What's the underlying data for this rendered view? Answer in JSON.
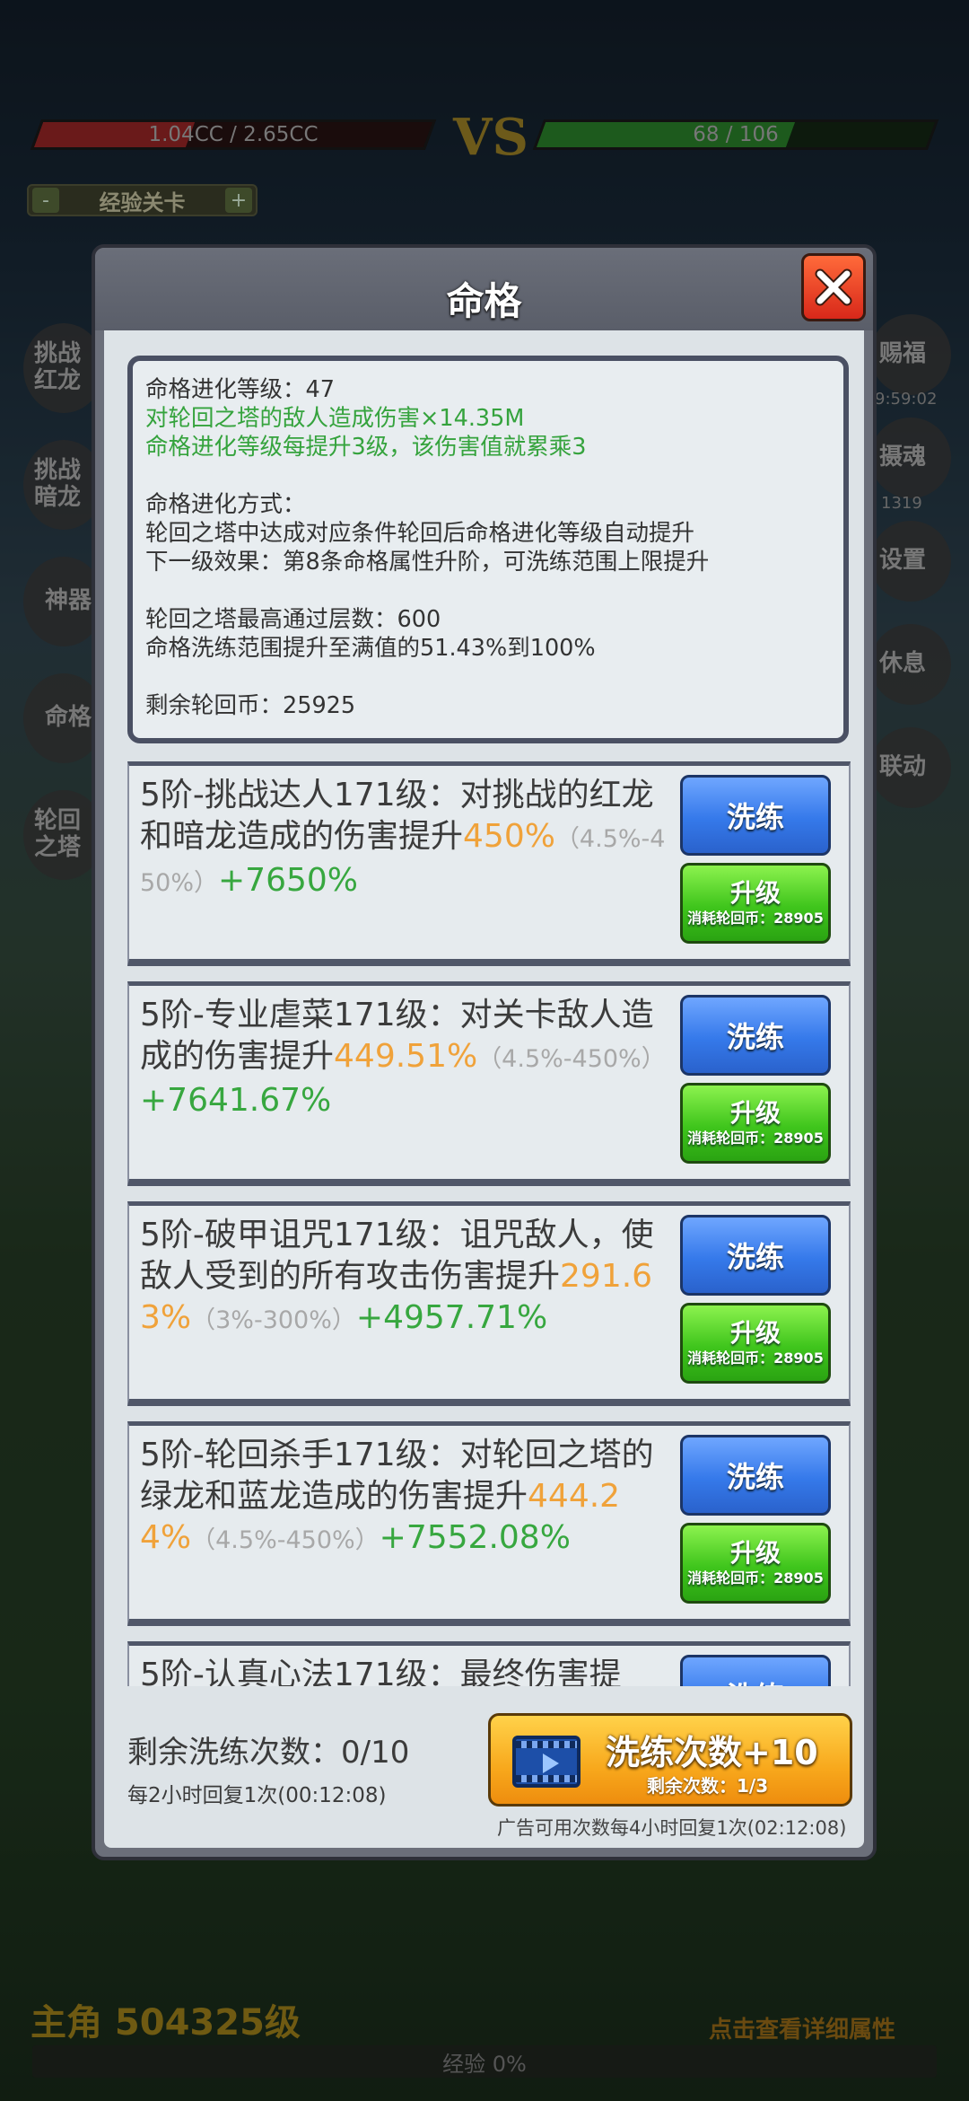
{
  "battle": {
    "player_hp": "1.04CC / 2.65CC",
    "enemy_hp": "68 / 106",
    "vs": "VS",
    "stage_label": "经验关卡",
    "minus": "-",
    "plus": "+"
  },
  "side_left": [
    "挑战红龙",
    "挑战暗龙",
    "神器",
    "命格",
    "轮回之塔"
  ],
  "side_right": {
    "blessing": "赐福",
    "blessing_timer": "9:59:02",
    "soul": "摄魂",
    "soul_count": "1319",
    "settings": "设置",
    "rest": "休息",
    "link": "联动"
  },
  "footer_bg": {
    "hero_level": "主角 504325级",
    "detail_link": "点击查看详细属性",
    "exp": "经验 0%"
  },
  "modal": {
    "title": "命格",
    "info": {
      "level_line": "命格进化等级：47",
      "damage_line": "对轮回之塔的敌人造成伤害×14.35M",
      "multiply_line": "命格进化等级每提升3级，该伤害值就累乘3",
      "method_title": "命格进化方式：",
      "method_line": "轮回之塔中达成对应条件轮回后命格进化等级自动提升",
      "next_line": "下一级效果：第8条命格属性升阶，可洗练范围上限提升",
      "max_floor": "轮回之塔最高通过层数：600",
      "range_line": "命格洗练范围提升至满值的51.43%到100%",
      "coins": "剩余轮回币：25925"
    },
    "cards": [
      {
        "prefix": "5阶-挑战达人171级：对挑战的红龙和暗龙造成的伤害提升",
        "value": "450%",
        "range": "（4.5%-450%）",
        "plus": "+7650%"
      },
      {
        "prefix": "5阶-专业虐菜171级：对关卡敌人造成的伤害提升",
        "value": "449.51%",
        "range": "（4.5%-450%）",
        "plus": "+7641.67%"
      },
      {
        "prefix": "5阶-破甲诅咒171级：诅咒敌人，使敌人受到的所有攻击伤害提升",
        "value": "291.63%",
        "range": "（3%-300%）",
        "plus": "+4957.71%"
      },
      {
        "prefix": "5阶-轮回杀手171级：对轮回之塔的绿龙和蓝龙造成的伤害提升",
        "value": "444.24%",
        "range": "（4.5%-450%）",
        "plus": "+7552.08%"
      },
      {
        "prefix": "5阶-认真心法171级：最终伤害提",
        "value": "",
        "range": "",
        "plus": ""
      }
    ],
    "refine_label": "洗练",
    "upgrade_label": "升级",
    "upgrade_cost": "消耗轮回币：28905",
    "remaining_refines": "剩余洗练次数：0/10",
    "recover_note": "每2小时回复1次(00:12:08)",
    "ad_button_title": "洗练次数+10",
    "ad_button_sub": "剩余次数：1/3",
    "ad_note": "广告可用次数每4小时回复1次(02:12:08)"
  },
  "colors": {
    "accent_orange": "#f0a23a",
    "accent_green": "#37a73f",
    "button_blue": "#3579ea",
    "button_green": "#3fc51c"
  },
  "bars": {
    "player_hp_fraction": 0.39,
    "enemy_hp_fraction": 0.64
  }
}
